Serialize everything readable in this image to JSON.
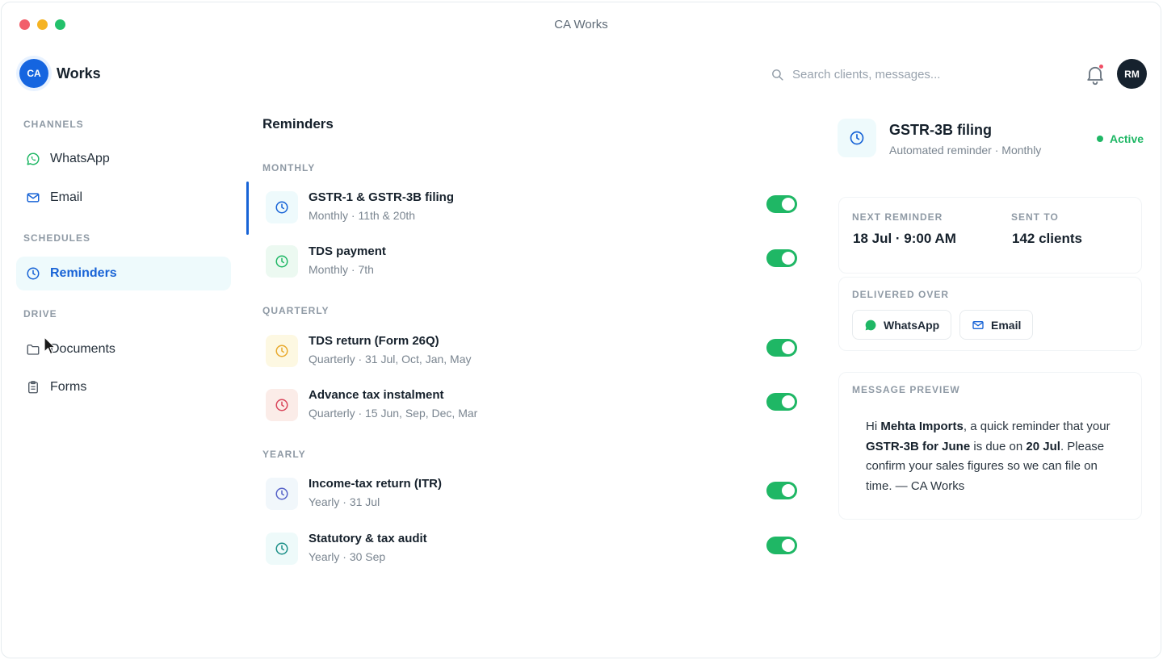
{
  "window": {
    "title": "CA Works"
  },
  "brand": {
    "badge": "CA",
    "name": "Works"
  },
  "search": {
    "placeholder": "Search clients, messages..."
  },
  "user": {
    "initials": "RM"
  },
  "sidebar": {
    "sections": [
      "CHANNELS",
      "SCHEDULES",
      "DRIVE"
    ],
    "items": [
      {
        "label": "WhatsApp",
        "icon": "whatsapp-icon"
      },
      {
        "label": "Email",
        "icon": "mail-icon"
      },
      {
        "label": "Reminders",
        "icon": "clock-icon",
        "active": true
      },
      {
        "label": "Documents",
        "icon": "folder-icon"
      },
      {
        "label": "Forms",
        "icon": "clipboard-icon"
      }
    ]
  },
  "reminders": {
    "title": "Reminders",
    "groups": [
      {
        "label": "MONTHLY",
        "items": [
          {
            "title": "GSTR-1 & GSTR-3B filing",
            "sub": "Monthly · 11th & 20th",
            "enabled": true,
            "selected": true,
            "color": "#1763d6",
            "bg": "#eefafc"
          },
          {
            "title": "TDS payment",
            "sub": "Monthly · 7th",
            "enabled": true,
            "color": "#1fb765",
            "bg": "#ecf9f1"
          }
        ]
      },
      {
        "label": "QUARTERLY",
        "items": [
          {
            "title": "TDS return (Form 26Q)",
            "sub": "Quarterly · 31 Jul, Oct, Jan, May",
            "enabled": true,
            "color": "#e8a92c",
            "bg": "#fdf8e2"
          },
          {
            "title": "Advance tax instalment",
            "sub": "Quarterly · 15 Jun, Sep, Dec, Mar",
            "enabled": true,
            "color": "#d9445a",
            "bg": "#fbece8"
          }
        ]
      },
      {
        "label": "YEARLY",
        "items": [
          {
            "title": "Income-tax return (ITR)",
            "sub": "Yearly · 31 Jul",
            "enabled": true,
            "color": "#5561c8",
            "bg": "#f1f7fb"
          },
          {
            "title": "Statutory & tax audit",
            "sub": "Yearly · 30 Sep",
            "enabled": true,
            "color": "#1a8f87",
            "bg": "#eefafa"
          }
        ]
      }
    ]
  },
  "detail": {
    "title": "GSTR-3B filing",
    "subtitle": "Automated reminder · Monthly",
    "status": "Active",
    "next_label": "NEXT REMINDER",
    "next_value": "18 Jul · 9:00 AM",
    "sent_label": "SENT TO",
    "sent_value": "142 clients",
    "delivered_label": "DELIVERED OVER",
    "channels": [
      "WhatsApp",
      "Email"
    ],
    "preview_label": "MESSAGE PREVIEW",
    "preview": {
      "p1": "Hi ",
      "b1": "Mehta Imports",
      "p2": ", a quick reminder that your ",
      "b2": "GSTR-3B for June",
      "p3": " is due on ",
      "b3": "20 Jul",
      "p4": ". Please confirm your sales figures so we can file on time. — CA Works"
    }
  },
  "colors": {
    "accent": "#1763d6",
    "success": "#1fb765",
    "brand": "#1565e0"
  }
}
